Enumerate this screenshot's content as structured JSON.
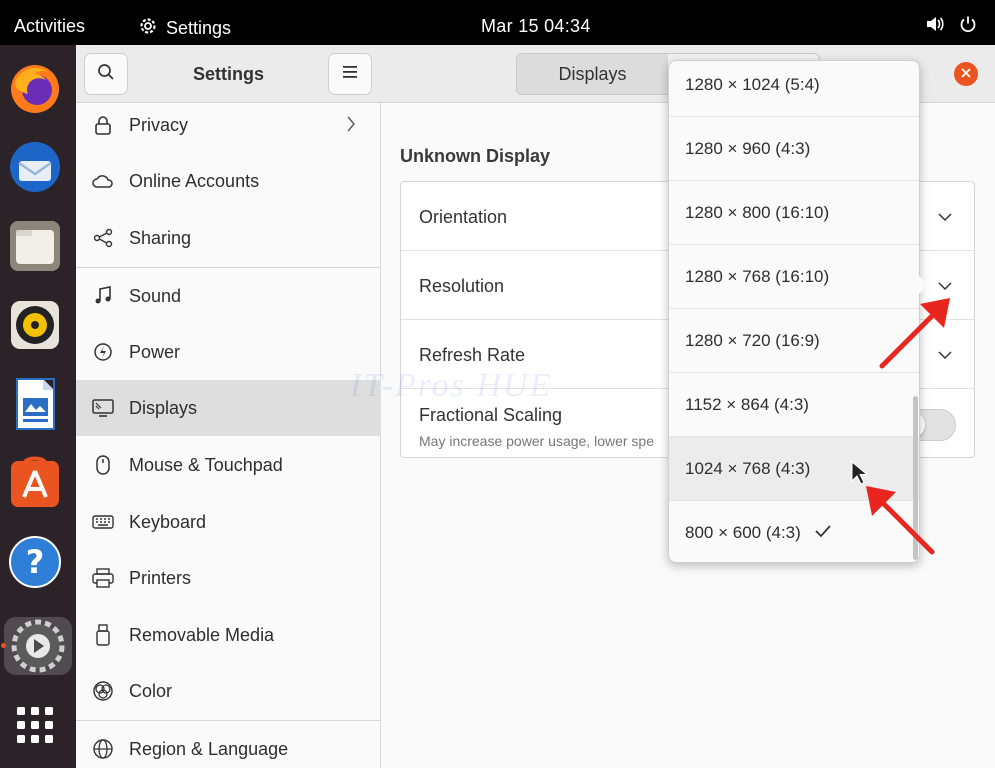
{
  "topbar": {
    "activities": "Activities",
    "app_name": "Settings",
    "clock": "Mar 15  04:34",
    "icons": [
      "gear-icon",
      "speaker-icon",
      "power-icon"
    ]
  },
  "dock": {
    "apps": [
      "firefox",
      "thunderbird",
      "files",
      "rhythmbox",
      "libreoffice-writer",
      "ubuntu-software",
      "help",
      "settings",
      "show-applications"
    ]
  },
  "sidebar": {
    "title": "Settings",
    "items": [
      {
        "label": "Privacy",
        "icon": "lock-icon"
      },
      {
        "label": "Online Accounts",
        "icon": "cloud-icon"
      },
      {
        "label": "Sharing",
        "icon": "share-icon"
      },
      {
        "label": "Sound",
        "icon": "music-note-icon"
      },
      {
        "label": "Power",
        "icon": "power-icon"
      },
      {
        "label": "Displays",
        "icon": "monitor-icon"
      },
      {
        "label": "Mouse & Touchpad",
        "icon": "mouse-icon"
      },
      {
        "label": "Keyboard",
        "icon": "keyboard-icon"
      },
      {
        "label": "Printers",
        "icon": "printer-icon"
      },
      {
        "label": "Removable Media",
        "icon": "usb-icon"
      },
      {
        "label": "Color",
        "icon": "color-icon"
      },
      {
        "label": "Region & Language",
        "icon": "globe-icon"
      }
    ],
    "selected": "Displays"
  },
  "header": {
    "tab_displays": "Displays",
    "tab_second": ""
  },
  "main": {
    "display_name": "Unknown Display",
    "rows": {
      "orientation": "Orientation",
      "resolution": "Resolution",
      "refresh_rate": "Refresh Rate",
      "fractional_scaling": "Fractional Scaling",
      "fractional_scaling_sub": "May increase power usage, lower spe"
    },
    "fractional_scaling_on": false
  },
  "resolution_menu": {
    "options": [
      "1280 × 1024 (5:4)",
      "1280 × 960 (4:3)",
      "1280 × 800 (16:10)",
      "1280 × 768 (16:10)",
      "1280 × 720 (16:9)",
      "1152 × 864 (4:3)",
      "1024 × 768 (4:3)",
      "800 × 600 (4:3)"
    ],
    "hovered": "1024 × 768 (4:3)",
    "checked": "800 × 600 (4:3)"
  },
  "watermark": "IT-Pros HUE",
  "colors": {
    "accent": "#e95420",
    "annotation_arrow": "#e8261f"
  }
}
